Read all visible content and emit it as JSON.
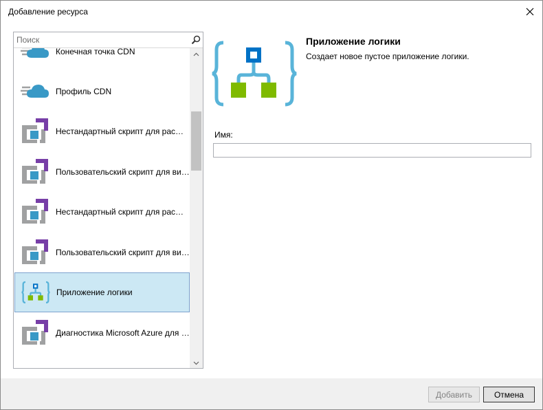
{
  "window": {
    "title": "Добавление ресурса"
  },
  "search": {
    "placeholder": "Поиск",
    "value": ""
  },
  "list": {
    "items": [
      {
        "label": "Конечная точка CDN",
        "icon": "cdn-cloud-icon",
        "selected": false
      },
      {
        "label": "Профиль CDN",
        "icon": "cdn-cloud-icon",
        "selected": false
      },
      {
        "label": "Нестандартный скрипт для расширения виртуальной машины",
        "icon": "vm-extension-icon",
        "selected": false
      },
      {
        "label": "Пользовательский скрипт для виртуальной машины",
        "icon": "vm-extension-icon",
        "selected": false
      },
      {
        "label": "Нестандартный скрипт для расширения виртуальной машины",
        "icon": "vm-extension-icon",
        "selected": false
      },
      {
        "label": "Пользовательский скрипт для виртуальной машины",
        "icon": "vm-extension-icon",
        "selected": false
      },
      {
        "label": "Приложение логики",
        "icon": "logic-app-icon",
        "selected": true
      },
      {
        "label": "Диагностика Microsoft Azure для виртуальной машины",
        "icon": "vm-extension-icon",
        "selected": false
      }
    ]
  },
  "detail": {
    "title": "Приложение логики",
    "description": "Создает новое пустое приложение логики.",
    "icon": "logic-app-icon"
  },
  "form": {
    "name_label": "Имя:",
    "name_value": ""
  },
  "footer": {
    "add_label": "Добавить",
    "cancel_label": "Отмена"
  },
  "colors": {
    "accent_blue": "#0072c6",
    "bracket_blue": "#59b4d9",
    "logic_green": "#7fba00",
    "vm_gray": "#a0a1a2",
    "vm_purple": "#773ea7",
    "cloud_blue": "#3999c6",
    "selected_bg": "#cce8f4"
  }
}
